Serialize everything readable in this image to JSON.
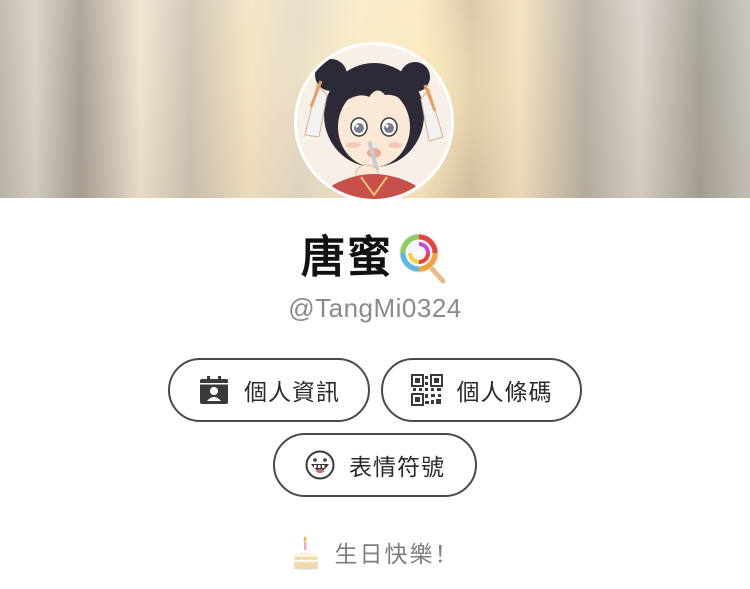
{
  "profile": {
    "display_name": "唐蜜",
    "name_emoji": "lollipop-icon",
    "user_id": "@TangMi0324"
  },
  "actions": {
    "profile_info_label": "個人資訊",
    "qr_code_label": "個人條碼",
    "sticker_label": "表情符號"
  },
  "birthday": {
    "message": "生日快樂！",
    "icon": "birthday-cake-icon"
  },
  "colors": {
    "button_border": "#4a4a4a",
    "handle_text": "#8b8b8b",
    "birthday_text": "#7e7e7e"
  }
}
